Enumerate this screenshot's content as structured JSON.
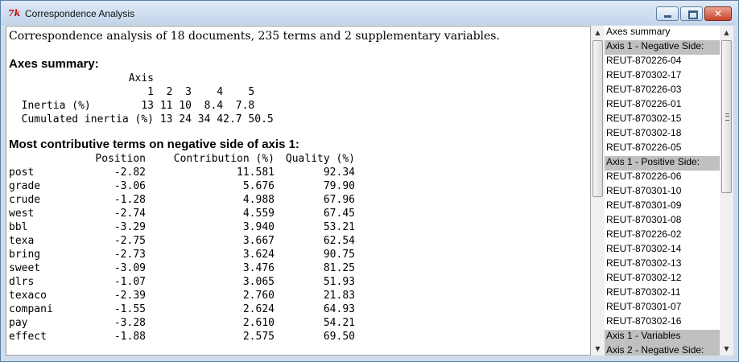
{
  "window": {
    "title": "Correspondence Analysis",
    "close_glyph": "✕"
  },
  "intro": "Correspondence analysis of 18 documents, 235 terms and 2 supplementary variables.",
  "axes_summary": {
    "heading": "Axes summary:",
    "table_text": "                   Axis\n                      1  2  3    4    5\n  Inertia (%)        13 11 10  8.4  7.8\n  Cumulated inertia (%) 13 24 34 42.7 50.5"
  },
  "terms_section": {
    "heading": "Most contributive terms on negative side of axis 1:",
    "columns": [
      "Position",
      "Contribution (%)",
      "Quality (%)"
    ],
    "rows": [
      {
        "term": "post",
        "position": "-2.82",
        "contribution": "11.581",
        "quality": "92.34"
      },
      {
        "term": "grade",
        "position": "-3.06",
        "contribution": "5.676",
        "quality": "79.90"
      },
      {
        "term": "crude",
        "position": "-1.28",
        "contribution": "4.988",
        "quality": "67.96"
      },
      {
        "term": "west",
        "position": "-2.74",
        "contribution": "4.559",
        "quality": "67.45"
      },
      {
        "term": "bbl",
        "position": "-3.29",
        "contribution": "3.940",
        "quality": "53.21"
      },
      {
        "term": "texa",
        "position": "-2.75",
        "contribution": "3.667",
        "quality": "62.54"
      },
      {
        "term": "bring",
        "position": "-2.73",
        "contribution": "3.624",
        "quality": "90.75"
      },
      {
        "term": "sweet",
        "position": "-3.09",
        "contribution": "3.476",
        "quality": "81.25"
      },
      {
        "term": "dlrs",
        "position": "-1.07",
        "contribution": "3.065",
        "quality": "51.93"
      },
      {
        "term": "texaco",
        "position": "-2.39",
        "contribution": "2.760",
        "quality": "21.83"
      },
      {
        "term": "compani",
        "position": "-1.55",
        "contribution": "2.624",
        "quality": "64.93"
      },
      {
        "term": "pay",
        "position": "-3.28",
        "contribution": "2.610",
        "quality": "54.21"
      },
      {
        "term": "effect",
        "position": "-1.88",
        "contribution": "2.575",
        "quality": "69.50"
      }
    ]
  },
  "sidebar": {
    "items": [
      {
        "label": "Axes summary",
        "selected": false
      },
      {
        "label": "Axis 1 - Negative Side:",
        "selected": true
      },
      {
        "label": "REUT-870226-04",
        "selected": false
      },
      {
        "label": "REUT-870302-17",
        "selected": false
      },
      {
        "label": "REUT-870226-03",
        "selected": false
      },
      {
        "label": "REUT-870226-01",
        "selected": false
      },
      {
        "label": "REUT-870302-15",
        "selected": false
      },
      {
        "label": "REUT-870302-18",
        "selected": false
      },
      {
        "label": "REUT-870226-05",
        "selected": false
      },
      {
        "label": "Axis 1 - Positive Side:",
        "selected": true
      },
      {
        "label": "REUT-870226-06",
        "selected": false
      },
      {
        "label": "REUT-870301-10",
        "selected": false
      },
      {
        "label": "REUT-870301-09",
        "selected": false
      },
      {
        "label": "REUT-870301-08",
        "selected": false
      },
      {
        "label": "REUT-870226-02",
        "selected": false
      },
      {
        "label": "REUT-870302-14",
        "selected": false
      },
      {
        "label": "REUT-870302-13",
        "selected": false
      },
      {
        "label": "REUT-870302-12",
        "selected": false
      },
      {
        "label": "REUT-870302-11",
        "selected": false
      },
      {
        "label": "REUT-870301-07",
        "selected": false
      },
      {
        "label": "REUT-870302-16",
        "selected": false
      },
      {
        "label": "Axis 1 - Variables",
        "selected": true
      },
      {
        "label": "Axis 2 - Negative Side:",
        "selected": true
      }
    ]
  }
}
